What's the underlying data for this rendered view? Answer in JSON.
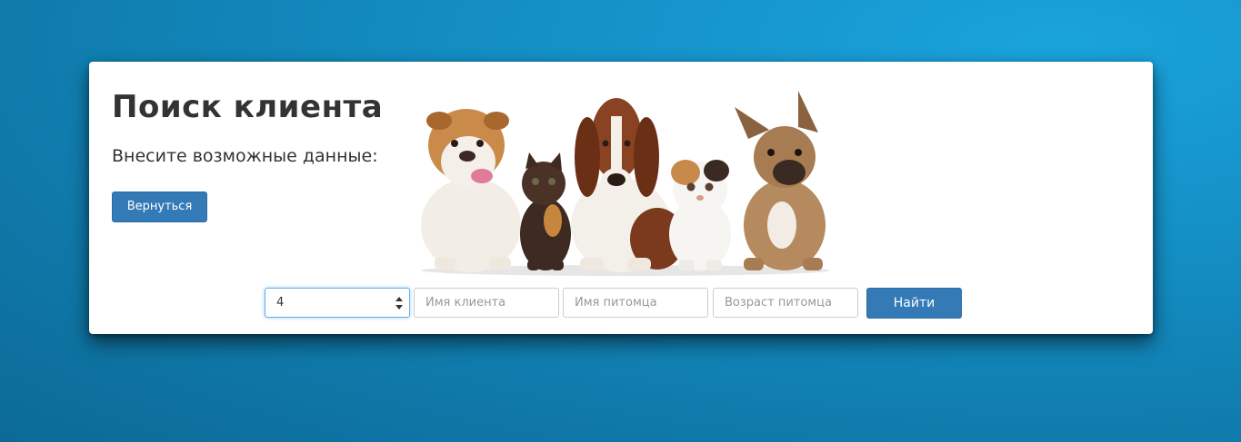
{
  "page": {
    "title": "Поиск клиента",
    "subtitle": "Внесите возможные данные:",
    "back_button": "Вернуться"
  },
  "search_form": {
    "id_value": "4",
    "client_name_placeholder": "Имя клиента",
    "pet_name_placeholder": "Имя питомца",
    "pet_age_placeholder": "Возраст питомца",
    "submit_label": "Найти"
  },
  "colors": {
    "accent": "#337ab7",
    "background": "#1490c6",
    "card": "#ffffff",
    "text": "#333333"
  },
  "image": {
    "name": "pets-banner"
  }
}
